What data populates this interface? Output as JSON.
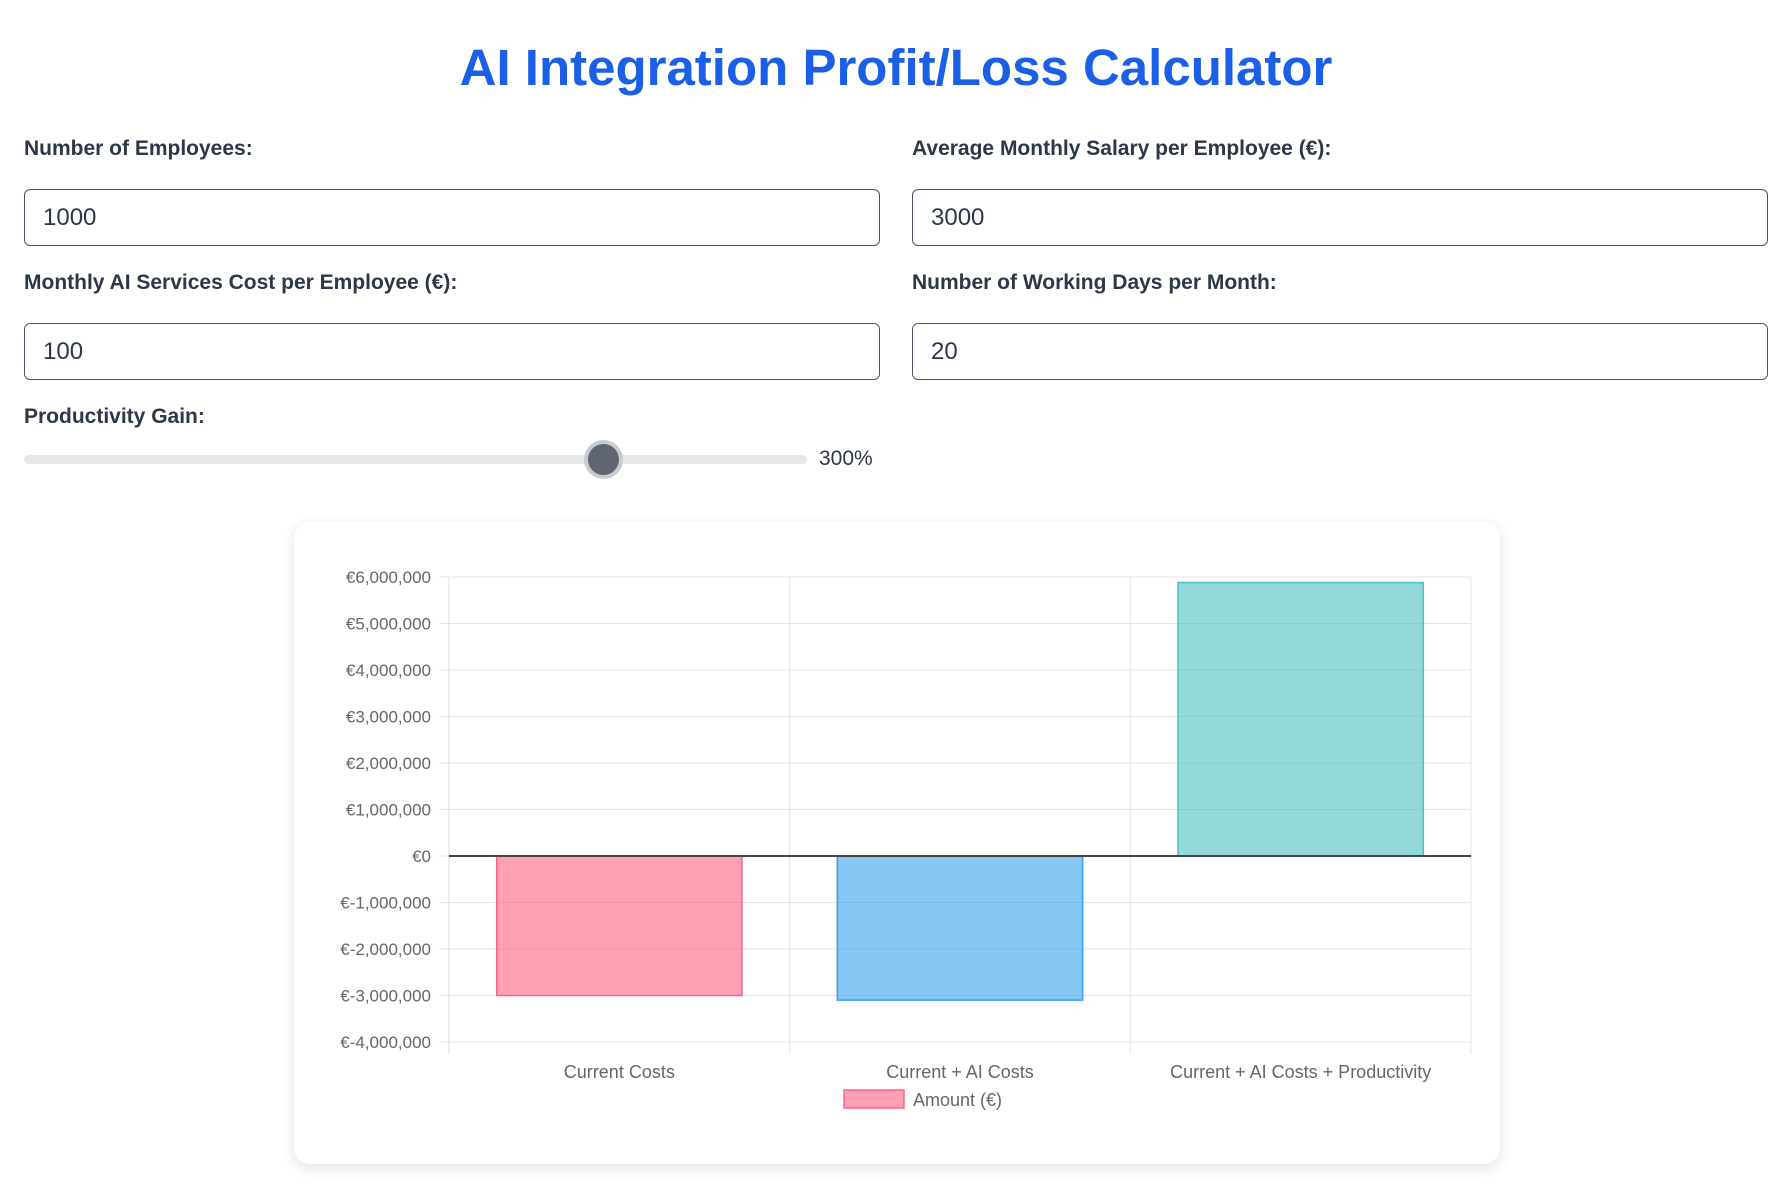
{
  "page": {
    "title": "AI Integration Profit/Loss Calculator"
  },
  "form": {
    "employees": {
      "label": "Number of Employees:",
      "value": "1000"
    },
    "salary": {
      "label": "Average Monthly Salary per Employee (€):",
      "value": "3000"
    },
    "ai_cost": {
      "label": "Monthly AI Services Cost per Employee (€):",
      "value": "100"
    },
    "working_days": {
      "label": "Number of Working Days per Month:",
      "value": "20"
    },
    "productivity": {
      "label": "Productivity Gain:",
      "value_text": "300%",
      "fraction": 0.74
    }
  },
  "colors": {
    "title": "#1a5fe6",
    "bar_fills": [
      "rgba(255,99,132,0.6)",
      "rgba(54,162,235,0.6)",
      "rgba(75,192,192,0.6)"
    ],
    "bar_strokes": [
      "#ff6384",
      "#36a2eb",
      "#4bc0c0"
    ]
  },
  "chart_data": {
    "type": "bar",
    "categories": [
      "Current Costs",
      "Current + AI Costs",
      "Current + AI Costs + Productivity"
    ],
    "series": [
      {
        "name": "Amount (€)",
        "values": [
          -3000000,
          -3100000,
          5880000
        ]
      }
    ],
    "ylim": [
      -4000000,
      6000000
    ],
    "yticks": [
      6000000,
      5000000,
      4000000,
      3000000,
      2000000,
      1000000,
      0,
      -1000000,
      -2000000,
      -3000000,
      -4000000
    ],
    "ytick_labels": [
      "€6,000,000",
      "€5,000,000",
      "€4,000,000",
      "€3,000,000",
      "€2,000,000",
      "€1,000,000",
      "€0",
      "€-1,000,000",
      "€-2,000,000",
      "€-3,000,000",
      "€-4,000,000"
    ],
    "grid": true,
    "legend": "bottom"
  }
}
